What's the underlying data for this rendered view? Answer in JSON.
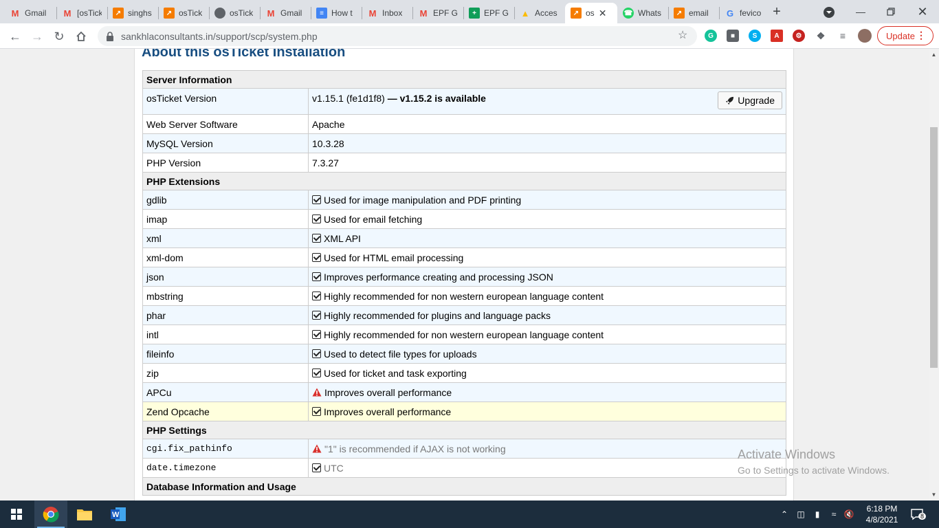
{
  "browser": {
    "tabs": [
      {
        "title": "Gmail",
        "icon": "gmail-icon",
        "color": "#ea4335"
      },
      {
        "title": "[osTick",
        "icon": "gmail-icon",
        "color": "#ea4335"
      },
      {
        "title": "singhs",
        "icon": "osticket-icon",
        "color": "#f57c00"
      },
      {
        "title": "osTick",
        "icon": "osticket-icon",
        "color": "#f57c00"
      },
      {
        "title": "osTick",
        "icon": "globe-icon",
        "color": "#5f6368"
      },
      {
        "title": "Gmail",
        "icon": "gmail-icon",
        "color": "#ea4335"
      },
      {
        "title": "How t",
        "icon": "docs-icon",
        "color": "#4285f4"
      },
      {
        "title": "Inbox",
        "icon": "gmail-icon",
        "color": "#ea4335"
      },
      {
        "title": "EPF G",
        "icon": "gmail-icon",
        "color": "#ea4335"
      },
      {
        "title": "EPF G",
        "icon": "sheets-icon",
        "color": "#0f9d58"
      },
      {
        "title": "Acces",
        "icon": "drive-icon",
        "color": "#fbbc04"
      },
      {
        "title": "os",
        "icon": "osticket-icon",
        "color": "#f57c00",
        "active": true
      },
      {
        "title": "Whats",
        "icon": "whatsapp-icon",
        "color": "#25d366"
      },
      {
        "title": "email",
        "icon": "osticket-icon",
        "color": "#f57c00"
      },
      {
        "title": "fevico",
        "icon": "google-icon",
        "color": "#4285f4"
      }
    ],
    "url": "sankhlaconsultants.in/support/scp/system.php",
    "update_label": "Update"
  },
  "page": {
    "title": "About this osTicket Installation",
    "sections": {
      "server": "Server Information",
      "extensions": "PHP Extensions",
      "settings": "PHP Settings",
      "database": "Database Information and Usage"
    },
    "server_rows": {
      "osticket_version_label": "osTicket Version",
      "osticket_version_value": "v1.15.1 (fe1d1f8)",
      "osticket_version_available": "— v1.15.2 is available",
      "upgrade_label": "Upgrade",
      "web_server_label": "Web Server Software",
      "web_server_value": "Apache",
      "mysql_label": "MySQL Version",
      "mysql_value": "10.3.28",
      "php_label": "PHP Version",
      "php_value": "7.3.27"
    },
    "extensions": [
      {
        "name": "gdlib",
        "desc": "Used for image manipulation and PDF printing",
        "status": "ok"
      },
      {
        "name": "imap",
        "desc": "Used for email fetching",
        "status": "ok"
      },
      {
        "name": "xml",
        "desc": "XML API",
        "status": "ok"
      },
      {
        "name": "xml-dom",
        "desc": "Used for HTML email processing",
        "status": "ok"
      },
      {
        "name": "json",
        "desc": "Improves performance creating and processing JSON",
        "status": "ok"
      },
      {
        "name": "mbstring",
        "desc": "Highly recommended for non western european language content",
        "status": "ok"
      },
      {
        "name": "phar",
        "desc": "Highly recommended for plugins and language packs",
        "status": "ok"
      },
      {
        "name": "intl",
        "desc": "Highly recommended for non western european language content",
        "status": "ok"
      },
      {
        "name": "fileinfo",
        "desc": "Used to detect file types for uploads",
        "status": "ok"
      },
      {
        "name": "zip",
        "desc": "Used for ticket and task exporting",
        "status": "ok"
      },
      {
        "name": "APCu",
        "desc": "Improves overall performance",
        "status": "warn"
      },
      {
        "name": "Zend Opcache",
        "desc": "Improves overall performance",
        "status": "ok"
      }
    ],
    "settings": [
      {
        "name": "cgi.fix_pathinfo",
        "desc": "\"1\" is recommended if AJAX is not working",
        "status": "warn"
      },
      {
        "name": "date.timezone",
        "desc": "UTC",
        "status": "ok"
      }
    ]
  },
  "overlay": {
    "activate_title": "Activate Windows",
    "activate_sub": "Go to Settings to activate Windows."
  },
  "taskbar": {
    "time": "6:18 PM",
    "date": "4/8/2021",
    "notifications": "8"
  }
}
